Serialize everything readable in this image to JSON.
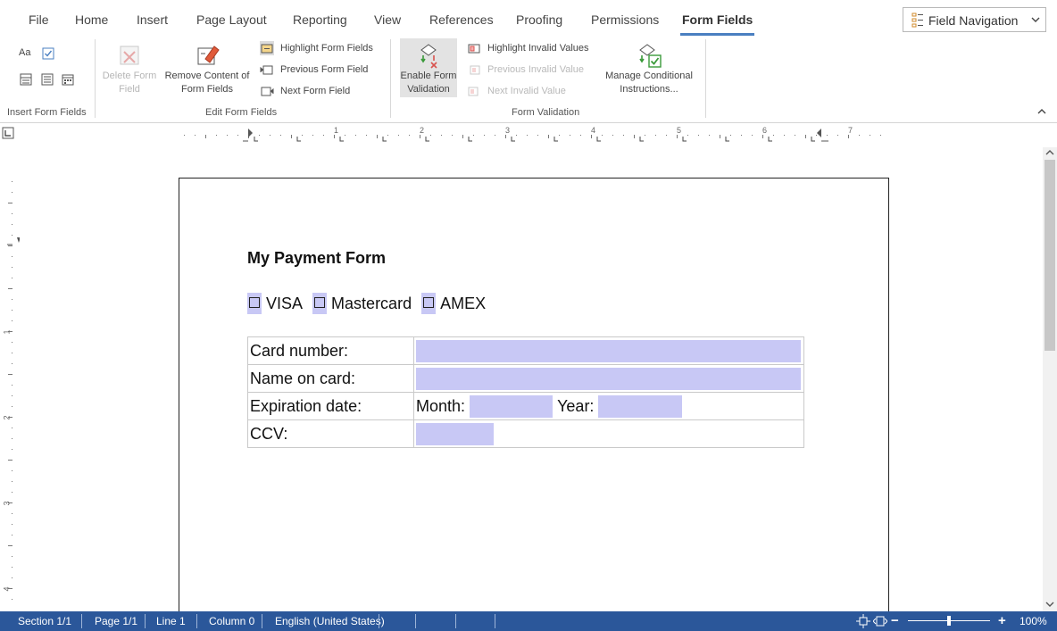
{
  "menu": {
    "tabs": [
      {
        "label": "File"
      },
      {
        "label": "Home"
      },
      {
        "label": "Insert"
      },
      {
        "label": "Page Layout"
      },
      {
        "label": "Reporting"
      },
      {
        "label": "View"
      },
      {
        "label": "References"
      },
      {
        "label": "Proofing"
      },
      {
        "label": "Permissions"
      },
      {
        "label": "Form Fields"
      }
    ],
    "active_tab": "Form Fields",
    "field_navigation": "Field Navigation"
  },
  "ribbon": {
    "groups": {
      "insert_form_fields": "Insert Form Fields",
      "edit_form_fields": "Edit Form Fields",
      "form_validation": "Form Validation"
    },
    "delete_form_field": [
      "Delete Form",
      "Field"
    ],
    "remove_content": [
      "Remove Content of",
      "Form Fields"
    ],
    "highlight_form_fields": "Highlight Form Fields",
    "previous_form_field": "Previous Form Field",
    "next_form_field": "Next Form Field",
    "enable_form_validation": [
      "Enable Form",
      "Validation"
    ],
    "highlight_invalid_values": "Highlight Invalid Values",
    "previous_invalid_value": "Previous Invalid Value",
    "next_invalid_value": "Next Invalid Value",
    "manage_conditional": [
      "Manage Conditional",
      "Instructions..."
    ],
    "mini_text_label": "Aa"
  },
  "ruler": {
    "numbers": [
      "1",
      "2",
      "3",
      "4",
      "5",
      "6",
      "7"
    ],
    "vertical_numbers": [
      "1",
      "2",
      "3",
      "4"
    ]
  },
  "document": {
    "title": "My Payment Form",
    "card_types": [
      "VISA",
      "Mastercard",
      "AMEX"
    ],
    "rows": {
      "card_number": "Card number:",
      "name_on_card": "Name on card:",
      "expiration_date": "Expiration date:",
      "month": "Month:",
      "year": "Year:",
      "ccv": "CCV:"
    }
  },
  "status": {
    "section": "Section 1/1",
    "page": "Page 1/1",
    "line": "Line 1",
    "column": "Column 0",
    "language": "English (United States)",
    "zoom_minus": "−",
    "zoom_plus": "+",
    "zoom": "100%",
    "zoom_level_fraction": 0.5
  },
  "colors": {
    "accent": "#4a7fc1",
    "field_highlight": "#c8c8f5",
    "status_bar": "#2b579a"
  }
}
